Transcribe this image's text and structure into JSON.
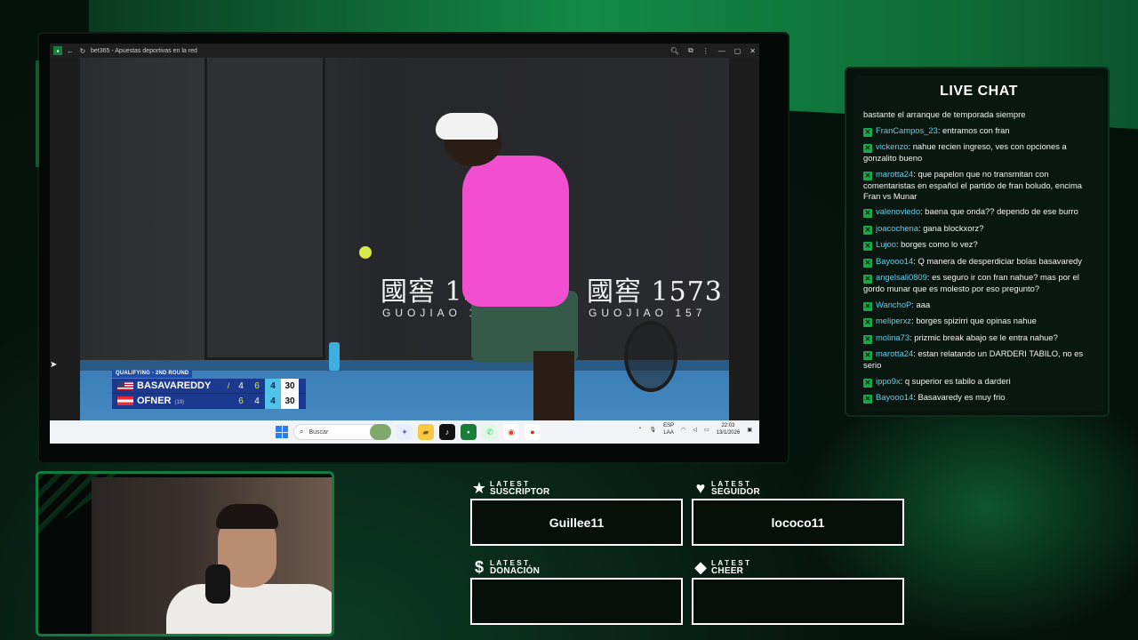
{
  "browser": {
    "title": "bet365 - Apuestas deportivas en la red"
  },
  "scoreboard": {
    "round": "QUALIFYING - 2ND ROUND",
    "players": [
      {
        "name": "BASAVAREDDY",
        "seed": "",
        "serving": true,
        "set1": "4",
        "set2": "6",
        "set3": "4",
        "points": "30"
      },
      {
        "name": "OFNER",
        "seed": "(19)",
        "serving": false,
        "set1": "6",
        "set2": "4",
        "set3": "4",
        "points": "30"
      }
    ]
  },
  "video": {
    "banner_left": "國窖 157",
    "banner_right": "國窖 1573",
    "banner_sub_left": "GUOJIAO 1",
    "banner_sub_right": "GUOJIAO 157"
  },
  "taskbar": {
    "search_placeholder": "Buscar",
    "lang_top": "ESP",
    "lang_bottom": "LAA",
    "time": "22:03",
    "date": "13/1/2026"
  },
  "chat": {
    "title": "LIVE CHAT",
    "first_line": "bastante el arranque de temporada siempre",
    "messages": [
      {
        "user": "FranCampos_23",
        "text": "entramos con fran"
      },
      {
        "user": "vickenzo",
        "text": "nahue recien ingreso, ves con opciones a gonzalito bueno"
      },
      {
        "user": "marotta24",
        "text": "que papelon que no transmitan con comentaristas en español el partido de fran boludo, encima Fran vs Munar"
      },
      {
        "user": "valenoviedo",
        "text": "baena que onda?? dependo de ese burro"
      },
      {
        "user": "joacochena",
        "text": "gana blockxorz?"
      },
      {
        "user": "Lujoo",
        "text": "borges como lo vez?"
      },
      {
        "user": "Bayooo14",
        "text": "Q manera de desperdiciar bolas basavaredy"
      },
      {
        "user": "angelsali0809",
        "text": "es seguro ir con fran nahue? mas por el gordo munar que es molesto por eso pregunto?"
      },
      {
        "user": "WanchoP",
        "text": "aaa"
      },
      {
        "user": "meliperxz",
        "text": "borges spizirri que opinas nahue"
      },
      {
        "user": "molina73",
        "text": "prizmic break abajo se le entra nahue?"
      },
      {
        "user": "marotta24",
        "text": "estan relatando un DARDERI TABILO, no es serio"
      },
      {
        "user": "ippo9x",
        "text": "q superior es tabilo a darderi"
      },
      {
        "user": "Bayooo14",
        "text": "Basavaredy es muy frio"
      }
    ]
  },
  "latest": {
    "suscriptor": {
      "small": "LATEST",
      "big": "SUSCRIPTOR",
      "value": "Guillee11",
      "icon": "star-icon"
    },
    "seguidor": {
      "small": "LATEST",
      "big": "SEGUIDOR",
      "value": "lococo11",
      "icon": "heart-icon"
    },
    "donacion": {
      "small": "LATEST",
      "big": "DONACIÓN",
      "value": "",
      "icon": "dollar-icon"
    },
    "cheer": {
      "small": "LATEST",
      "big": "CHEER",
      "value": "",
      "icon": "diamond-icon"
    }
  },
  "colors": {
    "accent_green": "#19a74a",
    "chat_username": "#67cde9",
    "score_highlight": "#4fc3e8"
  }
}
